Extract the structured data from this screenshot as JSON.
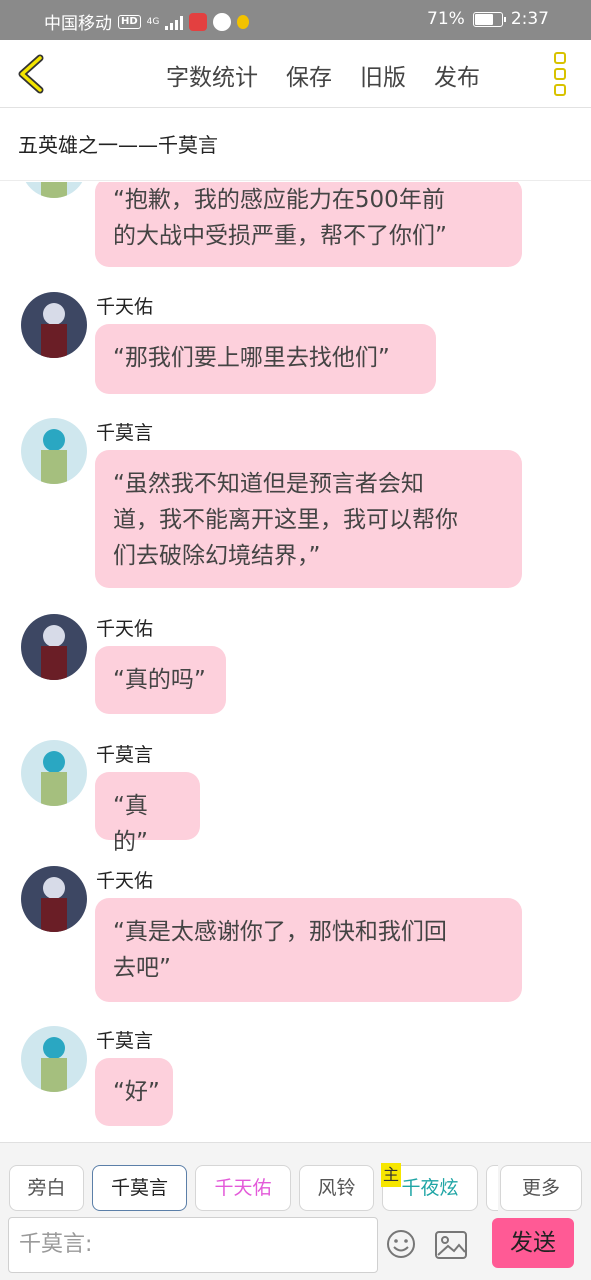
{
  "status_bar": {
    "carrier": "中国移动",
    "hd": "HD",
    "network": "4G",
    "battery_percent": "71%",
    "battery_level": 0.71,
    "time": "2:37"
  },
  "toolbar": {
    "word_count": "字数统计",
    "save": "保存",
    "old_version": "旧版",
    "publish": "发布"
  },
  "story_title": "五英雄之一——千莫言",
  "messages": [
    {
      "sender": "",
      "avatar": "qianmoyan",
      "text": "“抱歉，我的感应能力在500年前的大战中受损严重，帮不了你们”",
      "line1": "“抱歉，我的感应能力在500年前",
      "line2": "的大战中受损严重，帮不了你们”"
    },
    {
      "sender": "千天佑",
      "avatar": "qiantianyou",
      "text": "“那我们要上哪里去找他们”"
    },
    {
      "sender": "千莫言",
      "avatar": "qianmoyan",
      "line1": "“虽然我不知道但是预言者会知",
      "line2": "道，我不能离开这里，我可以帮你",
      "line3": "们去破除幻境结界，”"
    },
    {
      "sender": "千天佑",
      "avatar": "qiantianyou",
      "text": "“真的吗”"
    },
    {
      "sender": "千莫言",
      "avatar": "qianmoyan",
      "text": "“真的”"
    },
    {
      "sender": "千天佑",
      "avatar": "qiantianyou",
      "line1": "“真是太感谢你了，那快和我们回",
      "line2": "去吧”"
    },
    {
      "sender": "千莫言",
      "avatar": "qianmoyan",
      "text": "“好”"
    }
  ],
  "roles": [
    {
      "label": "旁白"
    },
    {
      "label": "千莫言"
    },
    {
      "label": "千天佑"
    },
    {
      "label": "风铃"
    },
    {
      "label": "千夜炫"
    },
    {
      "label": "更多"
    }
  ],
  "host_tag": "主",
  "input": {
    "prefix": "千莫言:"
  },
  "send_label": "发送",
  "colors": {
    "bubble": "#fdd0dc",
    "send": "#ff5a95",
    "accent_yellow": "#d8c200"
  }
}
